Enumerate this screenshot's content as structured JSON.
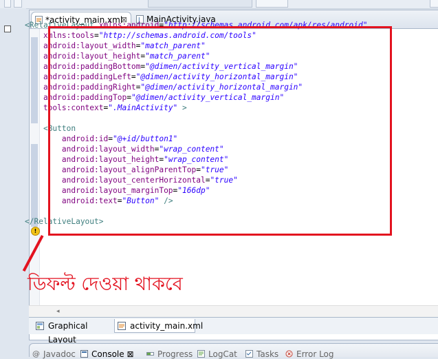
{
  "editor_tabs": [
    {
      "label": "*activity_main.xml",
      "close": "⊠"
    },
    {
      "label": "MainActivity.java"
    }
  ],
  "code_lines": [
    [
      {
        "t": "tag",
        "s": "<RelativeLayout "
      },
      {
        "t": "attr",
        "s": "xmlns:android"
      },
      {
        "t": "eq",
        "s": "="
      },
      {
        "t": "val",
        "s": "\"http://schemas.android.com/apk/res/android\""
      }
    ],
    [
      {
        "t": "attr",
        "s": "    xmlns:tools"
      },
      {
        "t": "eq",
        "s": "="
      },
      {
        "t": "val",
        "s": "\"http://schemas.android.com/tools\""
      }
    ],
    [
      {
        "t": "attr",
        "s": "    android:layout_width"
      },
      {
        "t": "eq",
        "s": "="
      },
      {
        "t": "val",
        "s": "\"match_parent\""
      }
    ],
    [
      {
        "t": "attr",
        "s": "    android:layout_height"
      },
      {
        "t": "eq",
        "s": "="
      },
      {
        "t": "val",
        "s": "\"match_parent\""
      }
    ],
    [
      {
        "t": "attr",
        "s": "    android:paddingBottom"
      },
      {
        "t": "eq",
        "s": "="
      },
      {
        "t": "val",
        "s": "\"@dimen/activity_vertical_margin\""
      }
    ],
    [
      {
        "t": "attr",
        "s": "    android:paddingLeft"
      },
      {
        "t": "eq",
        "s": "="
      },
      {
        "t": "val",
        "s": "\"@dimen/activity_horizontal_margin\""
      }
    ],
    [
      {
        "t": "attr",
        "s": "    android:paddingRight"
      },
      {
        "t": "eq",
        "s": "="
      },
      {
        "t": "val",
        "s": "\"@dimen/activity_horizontal_margin\""
      }
    ],
    [
      {
        "t": "attr",
        "s": "    android:paddingTop"
      },
      {
        "t": "eq",
        "s": "="
      },
      {
        "t": "val",
        "s": "\"@dimen/activity_vertical_margin\""
      }
    ],
    [
      {
        "t": "attr",
        "s": "    tools:context"
      },
      {
        "t": "eq",
        "s": "="
      },
      {
        "t": "val",
        "s": "\".MainActivity\""
      },
      {
        "t": "tag",
        "s": " >"
      }
    ],
    [],
    [
      {
        "t": "tag",
        "s": "    <Button"
      }
    ],
    [
      {
        "t": "attr",
        "s": "        android:id"
      },
      {
        "t": "eq",
        "s": "="
      },
      {
        "t": "val",
        "s": "\"@+id/button1\""
      }
    ],
    [
      {
        "t": "attr",
        "s": "        android:layout_width"
      },
      {
        "t": "eq",
        "s": "="
      },
      {
        "t": "val",
        "s": "\"wrap_content\""
      }
    ],
    [
      {
        "t": "attr",
        "s": "        android:layout_height"
      },
      {
        "t": "eq",
        "s": "="
      },
      {
        "t": "val",
        "s": "\"wrap_content\""
      }
    ],
    [
      {
        "t": "attr",
        "s": "        android:layout_alignParentTop"
      },
      {
        "t": "eq",
        "s": "="
      },
      {
        "t": "val",
        "s": "\"true\""
      }
    ],
    [
      {
        "t": "attr",
        "s": "        android:layout_centerHorizontal"
      },
      {
        "t": "eq",
        "s": "="
      },
      {
        "t": "val",
        "s": "\"true\""
      }
    ],
    [
      {
        "t": "attr",
        "s": "        android:layout_marginTop"
      },
      {
        "t": "eq",
        "s": "="
      },
      {
        "t": "val",
        "s": "\"166dp\""
      }
    ],
    [
      {
        "t": "attr",
        "s": "        android:text"
      },
      {
        "t": "eq",
        "s": "="
      },
      {
        "t": "val",
        "s": "\"Button\""
      },
      {
        "t": "tag",
        "s": " />"
      }
    ],
    [],
    [
      {
        "t": "tag",
        "s": "</RelativeLayout>"
      }
    ]
  ],
  "annotation": "ডিফল্ট দেওয়া থাকবে",
  "bottom_tabs": [
    {
      "label": "Graphical Layout"
    },
    {
      "label": "activity_main.xml"
    }
  ],
  "console_tabs": [
    {
      "label": "Javadoc"
    },
    {
      "label": "Console ⊠"
    },
    {
      "label": "Progress"
    },
    {
      "label": "LogCat"
    },
    {
      "label": "Tasks"
    },
    {
      "label": "Error Log"
    }
  ],
  "colors": {
    "highlight": "#e3121f",
    "tag": "#3f7f7f",
    "attr": "#7f007f",
    "value": "#2a00ff"
  }
}
